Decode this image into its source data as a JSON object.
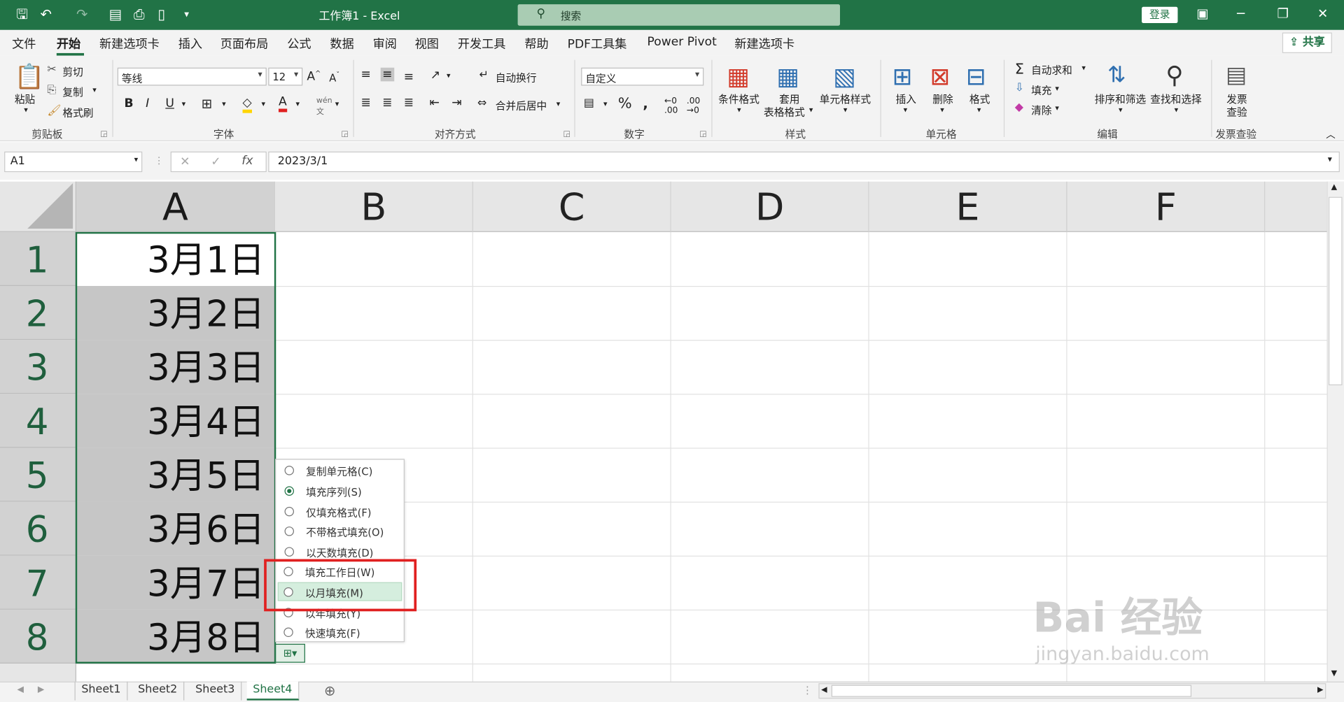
{
  "titlebar": {
    "title": "工作簿1  -  Excel",
    "search_placeholder": "搜索",
    "login": "登录"
  },
  "menu": {
    "tabs": [
      "文件",
      "开始",
      "新建选项卡",
      "插入",
      "页面布局",
      "公式",
      "数据",
      "审阅",
      "视图",
      "开发工具",
      "帮助",
      "PDF工具集",
      "Power Pivot",
      "新建选项卡"
    ],
    "share": "共享"
  },
  "ribbon": {
    "clipboard": {
      "paste": "粘贴",
      "cut": "剪切",
      "copy": "复制",
      "format_painter": "格式刷",
      "group": "剪贴板"
    },
    "font": {
      "name": "等线",
      "size": "12",
      "group": "字体"
    },
    "align": {
      "wrap": "自动换行",
      "merge": "合并后居中",
      "group": "对齐方式"
    },
    "number": {
      "format": "自定义",
      "group": "数字"
    },
    "styles": {
      "cond": "条件格式",
      "table_a": "套用",
      "table_b": "表格格式",
      "cell": "单元格样式",
      "group": "样式"
    },
    "cells": {
      "insert": "插入",
      "delete": "删除",
      "format": "格式",
      "group": "单元格"
    },
    "edit": {
      "autosum": "自动求和",
      "fill": "填充",
      "clear": "清除",
      "sort": "排序和筛选",
      "find": "查找和选择",
      "group": "编辑"
    },
    "invoice": {
      "a": "发票",
      "b": "查验",
      "group": "发票查验"
    }
  },
  "formula_bar": {
    "name_box": "A1",
    "formula": "2023/3/1"
  },
  "grid": {
    "columns": [
      "A",
      "B",
      "C",
      "D",
      "E",
      "F"
    ],
    "rows": [
      "1",
      "2",
      "3",
      "4",
      "5",
      "6",
      "7",
      "8"
    ],
    "a_values": [
      "3月1日",
      "3月2日",
      "3月3日",
      "3月4日",
      "3月5日",
      "3月6日",
      "3月7日",
      "3月8日"
    ]
  },
  "autofill_menu": {
    "options": [
      "复制单元格(C)",
      "填充序列(S)",
      "仅填充格式(F)",
      "不带格式填充(O)",
      "以天数填充(D)",
      "填充工作日(W)",
      "以月填充(M)",
      "以年填充(Y)",
      "快速填充(F)"
    ],
    "checked": "填充序列(S)",
    "highlighted": "以月填充(M)"
  },
  "sheets": [
    "Sheet1",
    "Sheet2",
    "Sheet3",
    "Sheet4"
  ],
  "active_sheet": "Sheet4",
  "watermark": {
    "main": "Bai 经验",
    "sub": "jingyan.baidu.com"
  },
  "colors": {
    "accent": "#217346",
    "highlight_box": "#e02020"
  }
}
